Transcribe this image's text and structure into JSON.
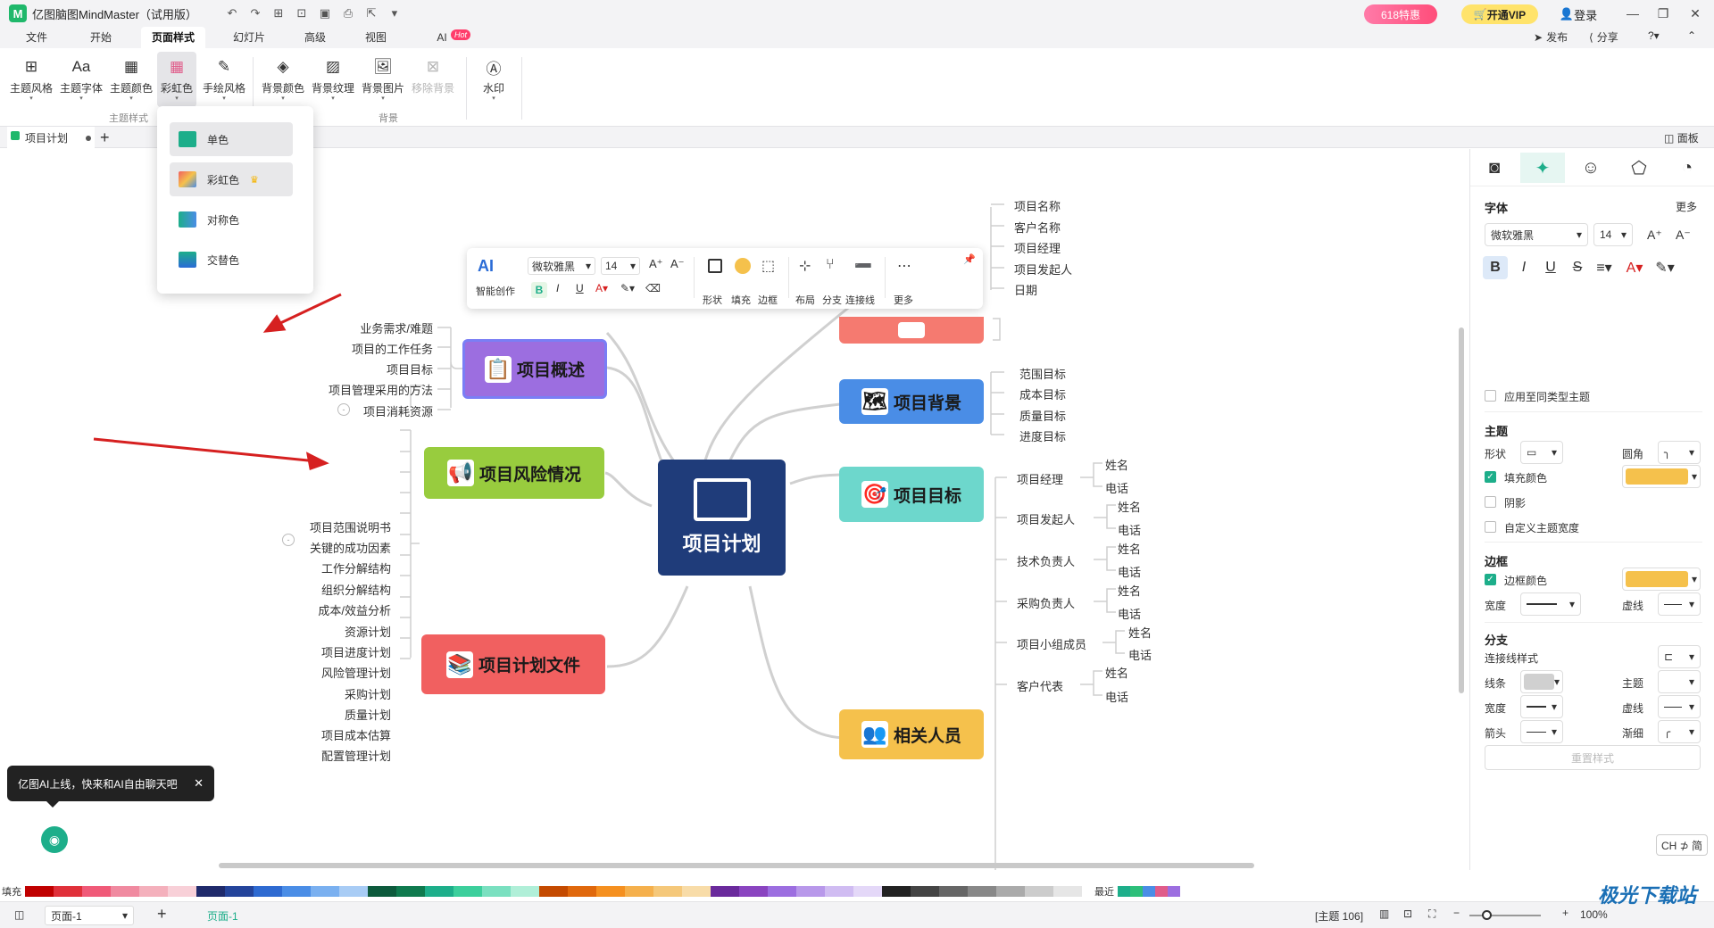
{
  "app": {
    "title": "亿图脑图MindMaster（试用版）",
    "promo": "618特惠",
    "vip": "开通VIP",
    "login": "登录"
  },
  "menu": {
    "tabs": [
      "文件",
      "开始",
      "页面样式",
      "幻灯片",
      "高级",
      "视图",
      "AI"
    ],
    "active": "页面样式",
    "hot": "Hot",
    "publish": "发布",
    "share": "分享"
  },
  "ribbon": {
    "buttons": [
      "主题风格",
      "主题字体",
      "主题颜色",
      "彩虹色",
      "手绘风格",
      "背景颜色",
      "背景纹理",
      "背景图片",
      "移除背景",
      "水印"
    ],
    "group_theme": "主题样式",
    "group_bg": "背景"
  },
  "doc": {
    "tab": "项目计划",
    "panel": "面板"
  },
  "dropdown": {
    "items": [
      "单色",
      "彩虹色",
      "对称色",
      "交替色"
    ]
  },
  "float_toolbar": {
    "ai": "AI",
    "ai_label": "智能创作",
    "font": "微软雅黑",
    "size": "14",
    "labels": [
      "形状",
      "填充",
      "边框",
      "布局",
      "分支",
      "连接线",
      "更多"
    ]
  },
  "mindmap": {
    "center": "项目计划",
    "overview": {
      "title": "项目概述",
      "items": [
        "业务需求/难题",
        "项目的工作任务",
        "项目目标",
        "项目管理采用的方法",
        "项目消耗资源"
      ]
    },
    "risk": {
      "title": "项目风险情况"
    },
    "plan_docs": {
      "title": "项目计划文件",
      "items": [
        "项目范围说明书",
        "关键的成功因素",
        "工作分解结构",
        "组织分解结构",
        "成本/效益分析",
        "资源计划",
        "项目进度计划",
        "风险管理计划",
        "采购计划",
        "质量计划",
        "项目成本估算",
        "配置管理计划"
      ]
    },
    "info": {
      "items": [
        "项目名称",
        "客户名称",
        "项目经理",
        "项目发起人",
        "日期"
      ]
    },
    "background": {
      "title": "项目背景"
    },
    "goals": {
      "title": "项目目标",
      "items": [
        "范围目标",
        "成本目标",
        "质量目标",
        "进度目标"
      ]
    },
    "people": {
      "title": "相关人员",
      "roles": [
        "项目经理",
        "项目发起人",
        "技术负责人",
        "采购负责人",
        "项目小组成员",
        "客户代表"
      ],
      "name": "姓名",
      "phone": "电话"
    }
  },
  "right_panel": {
    "font_section": "字体",
    "more": "更多",
    "font": "微软雅黑",
    "size": "14",
    "apply_same": "应用至同类型主题",
    "theme_section": "主题",
    "shape": "形状",
    "corner": "圆角",
    "fill_color": "填充颜色",
    "shadow": "阴影",
    "custom_width": "自定义主题宽度",
    "border_section": "边框",
    "border_color": "边框颜色",
    "width": "宽度",
    "dashed": "虚线",
    "branch_section": "分支",
    "line_style": "连接线样式",
    "line": "线条",
    "theme": "主题",
    "arrow": "箭头",
    "taper": "渐细",
    "reset": "重置样式",
    "fill_hex": "#f5c14c"
  },
  "bottom": {
    "fill_label": "填充",
    "recent": "最近",
    "page": "页面-1",
    "page_tab": "页面-1",
    "theme_count": "[主题 106]",
    "zoom": "100%",
    "ai_toast": "亿图AI上线，快来和AI自由聊天吧",
    "ch_btn": "CH ⊅ 简",
    "watermark": "极光下载站"
  }
}
